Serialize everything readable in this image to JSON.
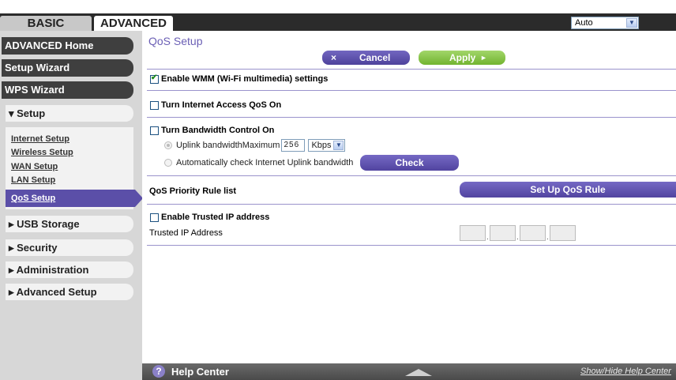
{
  "tabs": {
    "basic": "BASIC",
    "advanced": "ADVANCED"
  },
  "language": {
    "selected": "Auto"
  },
  "sidebar": {
    "main_items": [
      "ADVANCED Home",
      "Setup Wizard",
      "WPS Wizard"
    ],
    "setup_section": "▾ Setup",
    "setup_links": [
      "Internet Setup",
      "Wireless Setup",
      "WAN Setup",
      "LAN Setup"
    ],
    "active_link": "QoS Setup",
    "sections": [
      "▸ USB Storage",
      "▸ Security",
      "▸ Administration",
      "▸ Advanced Setup"
    ]
  },
  "page": {
    "title": "QoS Setup",
    "cancel_label": "Cancel",
    "cancel_icon": "×",
    "apply_label": "Apply",
    "apply_icon": "►",
    "wmm_label": "Enable WMM (Wi-Fi multimedia) settings",
    "wmm_checked": true,
    "internet_qos_label": "Turn Internet Access QoS On",
    "bandwidth_label": "Turn Bandwidth Control On",
    "uplink_label": "Uplink bandwidthMaximum",
    "uplink_value": "256",
    "uplink_unit": "Kbps",
    "auto_check_label": "Automatically check Internet Uplink bandwidth",
    "check_label": "Check",
    "priority_rule_label": "QoS Priority Rule list",
    "setup_rule_label": "Set Up QoS Rule",
    "trusted_ip_enable_label": "Enable Trusted IP address",
    "trusted_ip_label": "Trusted IP Address"
  },
  "help": {
    "icon": "?",
    "title": "Help Center",
    "toggle": "Show/Hide Help Center"
  }
}
